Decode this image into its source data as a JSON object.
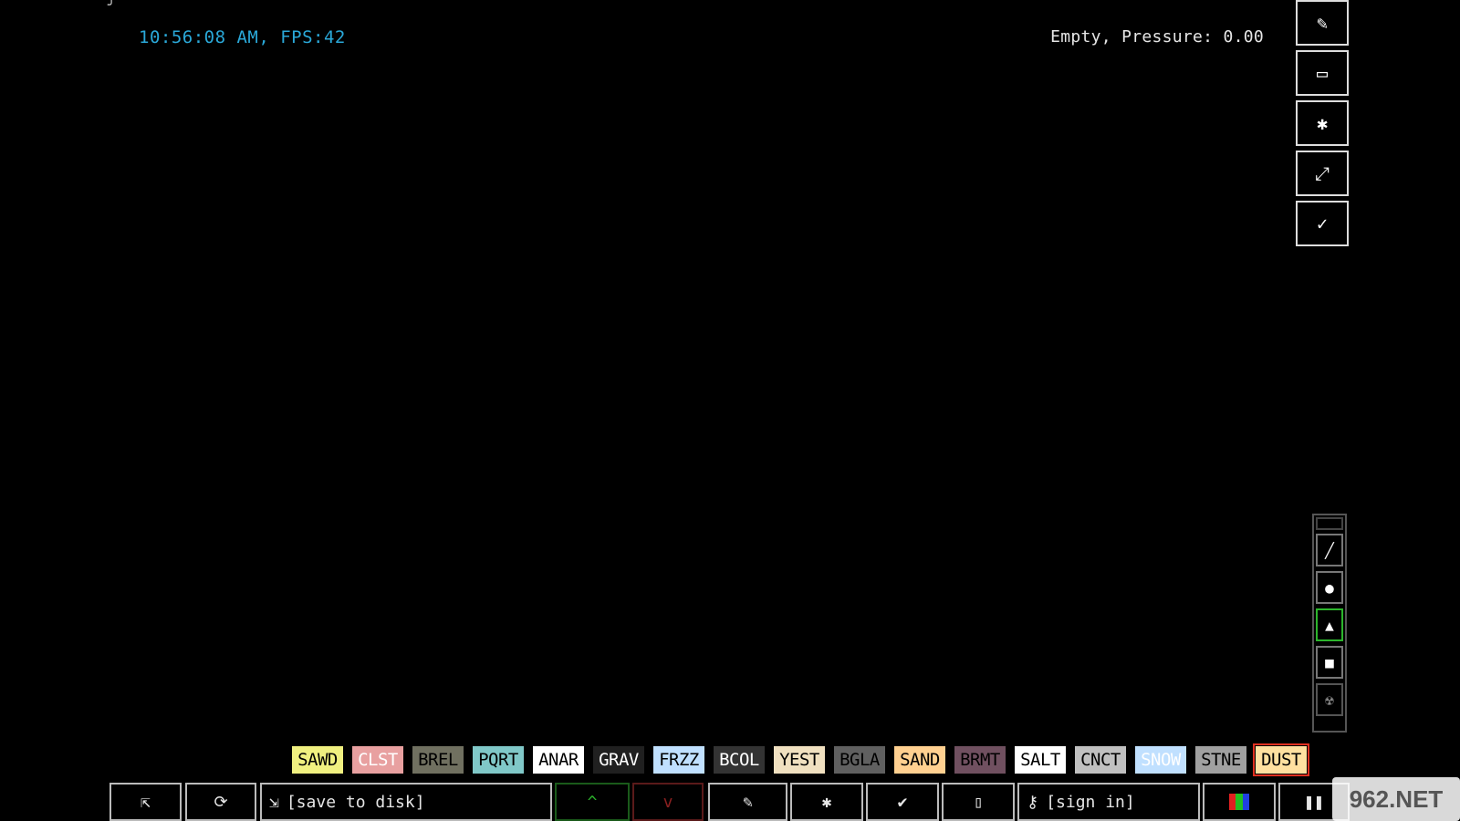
{
  "hud": {
    "time_fps": "10:56:08 AM, FPS:42",
    "status": "Empty, Pressure: 0.00"
  },
  "right_tools": [
    {
      "name": "eraser-icon",
      "glyph": "✎"
    },
    {
      "name": "console-icon",
      "glyph": "▭"
    },
    {
      "name": "settings-gear-icon",
      "glyph": "✱"
    },
    {
      "name": "resize-icon",
      "glyph": "⤢"
    },
    {
      "name": "tools-icon",
      "glyph": "✓"
    }
  ],
  "menu_categories": [
    {
      "name": "walls-icon",
      "glyph": "▬"
    },
    {
      "name": "electronics-icon",
      "glyph": "╱"
    },
    {
      "name": "liquids-icon",
      "glyph": "●"
    },
    {
      "name": "powders-icon",
      "glyph": "▲",
      "active": true
    },
    {
      "name": "solids-icon",
      "glyph": "■"
    },
    {
      "name": "radioactive-icon",
      "glyph": "☢"
    }
  ],
  "elements": [
    {
      "label": "SAWD",
      "bg": "#f0f080",
      "fg": "#000"
    },
    {
      "label": "CLST",
      "bg": "#e8a0a0",
      "fg": "#fff"
    },
    {
      "label": "BREL",
      "bg": "#707060",
      "fg": "#000"
    },
    {
      "label": "PQRT",
      "bg": "#80c8c8",
      "fg": "#000"
    },
    {
      "label": "ANAR",
      "bg": "#ffffff",
      "fg": "#000"
    },
    {
      "label": "GRAV",
      "bg": "#202020",
      "fg": "#fff"
    },
    {
      "label": "FRZZ",
      "bg": "#c0e0ff",
      "fg": "#000"
    },
    {
      "label": "BCOL",
      "bg": "#333333",
      "fg": "#fff"
    },
    {
      "label": "YEST",
      "bg": "#f0e0c0",
      "fg": "#000"
    },
    {
      "label": "BGLA",
      "bg": "#606060",
      "fg": "#000"
    },
    {
      "label": "SAND",
      "bg": "#ffd090",
      "fg": "#000"
    },
    {
      "label": "BRMT",
      "bg": "#705060",
      "fg": "#000"
    },
    {
      "label": "SALT",
      "bg": "#ffffff",
      "fg": "#000"
    },
    {
      "label": "CNCT",
      "bg": "#c0c0c0",
      "fg": "#000"
    },
    {
      "label": "SNOW",
      "bg": "#c0e0ff",
      "fg": "#fff"
    },
    {
      "label": "STNE",
      "bg": "#a0a0a0",
      "fg": "#000"
    },
    {
      "label": "DUST",
      "bg": "#ffe0a0",
      "fg": "#000",
      "selected": true
    }
  ],
  "bottom_bar": {
    "open_icon": "⇱",
    "reload_icon": "⟳",
    "save_label": "[save to disk]",
    "vote_up": "^",
    "vote_down": "v",
    "tag_icon": "✎",
    "report_bug_icon": "✱",
    "options_icon": "✔",
    "new_icon": "▯",
    "sign_in_label": "[sign in]",
    "pause_icon": "❚❚"
  },
  "watermark": "962.NET"
}
